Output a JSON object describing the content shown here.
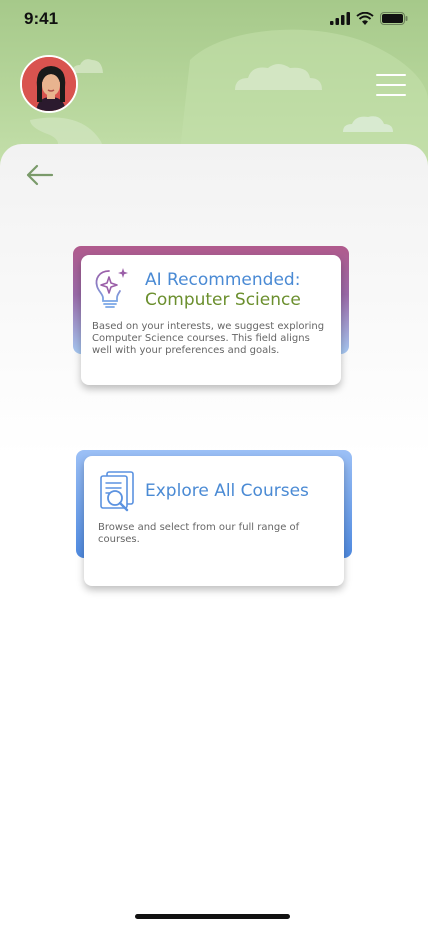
{
  "status_bar": {
    "time": "9:41"
  },
  "header": {
    "avatar_alt": "user avatar"
  },
  "cards": {
    "ai": {
      "title_line1": "AI Recommended:",
      "title_line2": "Computer Science",
      "description_line1": "Based on your interests, we suggest exploring",
      "description_line2": "Computer Science courses. This field aligns",
      "description_line3": "well with your preferences and goals."
    },
    "explore": {
      "title": "Explore All Courses",
      "description_line1": "Browse and select from our full range of",
      "description_line2": "courses."
    }
  },
  "colors": {
    "header_green": "#b8d79d",
    "ai_title_blue": "#4a8ad4",
    "ai_title_green": "#6b8f2e",
    "explore_blue": "#4a8ad4",
    "ai_accent_top": "#b05a8c",
    "ai_accent_bottom": "#a6c8f2",
    "explore_accent": "#6ea3ee",
    "back_arrow": "#7a9a6a"
  },
  "icons": {
    "back": "arrow-left-icon",
    "menu": "hamburger-menu-icon",
    "ai": "lightbulb-sparkle-icon",
    "explore": "document-search-icon",
    "signal": "signal-icon",
    "wifi": "wifi-icon",
    "battery": "battery-icon"
  }
}
